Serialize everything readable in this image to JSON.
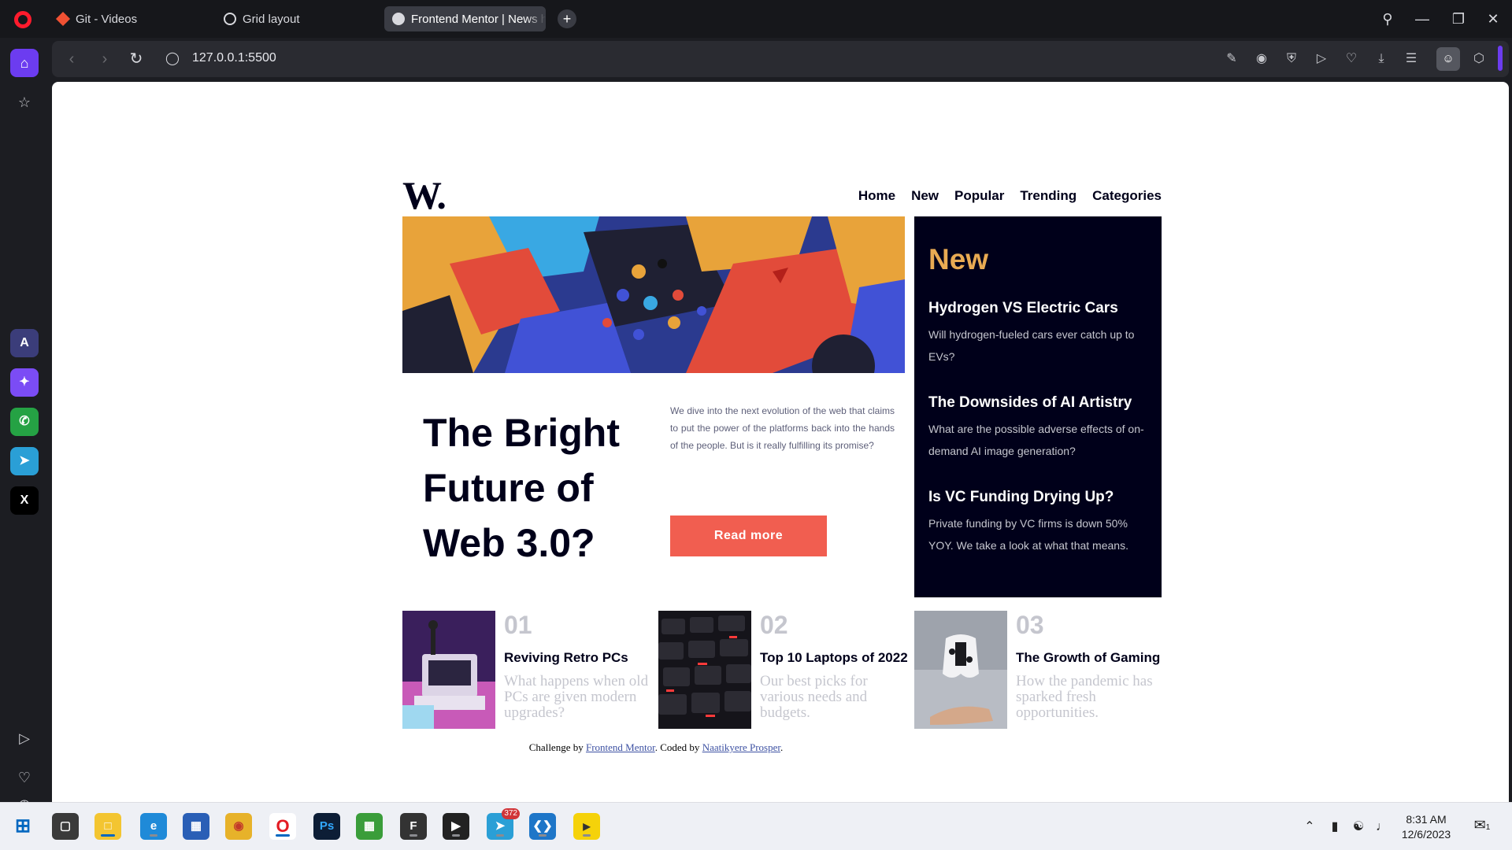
{
  "browser": {
    "tabs": [
      {
        "label": "Git - Videos",
        "icon": "git-icon"
      },
      {
        "label": "Grid layout",
        "icon": "globe-icon"
      },
      {
        "label": "Frontend Mentor | News h",
        "icon": "frontend-mentor-icon"
      }
    ],
    "new_tab_label": "+",
    "url": "127.0.0.1:5500",
    "accent_color": "#6c3cf0"
  },
  "site": {
    "logo": "W.",
    "menu": [
      "Home",
      "New",
      "Popular",
      "Trending",
      "Categories"
    ],
    "headline": "The Bright Future of Web 3.0?",
    "lede": "We dive into the next evolution of the web that claims to put the power of the platforms back into the hands of the people. But is it really fulfilling its promise?",
    "cta": "Read more",
    "new_panel": {
      "title": "New",
      "items": [
        {
          "title": "Hydrogen VS Electric Cars",
          "desc": "Will hydrogen-fueled cars ever catch up to EVs?"
        },
        {
          "title": "The Downsides of AI Artistry",
          "desc": "What are the possible adverse effects of on-demand AI image generation?"
        },
        {
          "title": "Is VC Funding Drying Up?",
          "desc": "Private funding by VC firms is down 50% YOY. We take a look at what that means."
        }
      ]
    },
    "cards": [
      {
        "num": "01",
        "title": "Reviving Retro PCs",
        "desc": "What happens when old PCs are given modern upgrades?"
      },
      {
        "num": "02",
        "title": "Top 10 Laptops of 2022",
        "desc": "Our best picks for various needs and budgets."
      },
      {
        "num": "03",
        "title": "The Growth of Gaming",
        "desc": "How the pandemic has sparked fresh opportunities."
      }
    ],
    "attribution": {
      "prefix": "Challenge by",
      "link1": "Frontend Mentor",
      "middle": ". Coded by",
      "link2": "Naatikyere Prosper",
      "suffix": "."
    },
    "colors": {
      "dark": "#00001a",
      "accent": "#f15e50",
      "gold": "#e9ab53",
      "muted": "#c5c6ce"
    }
  },
  "taskbar": {
    "telegram_badge": "372",
    "clock_time": "8:31 AM",
    "clock_date": "12/6/2023",
    "notification_count": "1"
  }
}
